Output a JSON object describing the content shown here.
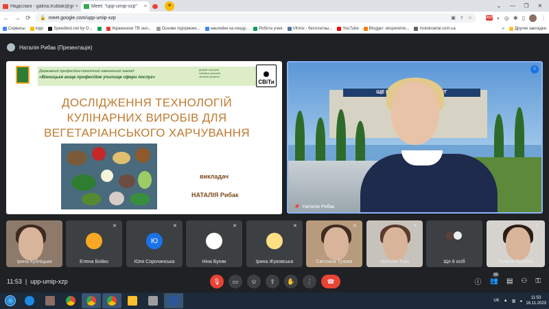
{
  "browser": {
    "tabs": [
      {
        "title": "Надіслані - galina.trublak@gm",
        "favicon_color": "#ea4335",
        "active": false
      },
      {
        "title": "Meet: \"upp-umip-xzp\"",
        "favicon_color": "#34a853",
        "active": true
      },
      {
        "title": "",
        "favicon_color": "#ea4335",
        "active": false
      }
    ],
    "tab_close": "×",
    "new_tab": "+",
    "window_controls": [
      "⌄",
      "—",
      "❐",
      "✕"
    ],
    "url": "meet.google.com/upp-umip-xzp",
    "nav_icons": [
      "←",
      "→",
      "⟳"
    ],
    "extension_badge": "ABP"
  },
  "bookmarks": [
    {
      "label": "Сервисы",
      "color": "#4285f4"
    },
    {
      "label": "logo",
      "color": "#fbbc04"
    },
    {
      "label": "Speedtest.net by O...",
      "color": "#1a1a1a"
    },
    {
      "label": "",
      "color": "#0f9d58"
    },
    {
      "label": "Украинское ТВ онл...",
      "color": "#e53935"
    },
    {
      "label": "Основи підприємн...",
      "color": "#9e9e9e"
    },
    {
      "label": "наклейки на конду...",
      "color": "#4285f4"
    },
    {
      "label": "Робота учня",
      "color": "#0f9d58"
    },
    {
      "label": "VKmix - бесплатны...",
      "color": "#4c75a3"
    },
    {
      "label": "YouTube",
      "color": "#ff0000"
    },
    {
      "label": "Blogger: ekspereme...",
      "color": "#f57c00"
    },
    {
      "label": "motokvartal.com.ua",
      "color": "#616161"
    }
  ],
  "bookmarks_more": "»",
  "bookmarks_folder": "Другие закладки",
  "meet": {
    "presenter_label": "Наталія Рибак (Презентація)",
    "slide": {
      "institution_line1": "Державний професійно-технічний навчальний заклад",
      "institution_line2": "«Вінницьке вище професійне училище сфери послуг»",
      "mottos": [
        "довіряй",
        "знай",
        "умій",
        "навчайся",
        "сучасний",
        "світовий",
        "професія"
      ],
      "logo_text": "СВіТи",
      "title_lines": [
        "ДОСЛІДЖЕННЯ ТЕХНОЛОГІЙ",
        "КУЛІНАРНИХ ВИРОБІВ ДЛЯ",
        "ВЕГЕТАРІАНСЬКОГО ХАРЧУВАННЯ"
      ],
      "lecturer_label": "викладач",
      "lecturer_name": "НАТАЛІЯ Рибак"
    },
    "speaker": {
      "name": "Наталія Рибак",
      "sign_text": "ЩЕ ПРОФЕС... ФЕРИ ПОСЛУГ"
    },
    "participants": [
      {
        "name": "Ірина Кубліцька",
        "type": "video",
        "muted": false
      },
      {
        "name": "Елена Бойко",
        "type": "avatar",
        "muted": true,
        "avatar_color": "#f9a825"
      },
      {
        "name": "Юля Сорочинська",
        "type": "letter",
        "muted": true,
        "letter": "Ю"
      },
      {
        "name": "Ніна Буняк",
        "type": "avatar",
        "muted": true,
        "avatar_color": "#ffffff"
      },
      {
        "name": "Ірина Жуковська",
        "type": "avatar",
        "muted": true,
        "avatar_color": "#ffe082"
      },
      {
        "name": "Світлана Тузова",
        "type": "video",
        "muted": true
      },
      {
        "name": "Наталія Ткач",
        "type": "video",
        "muted": true
      },
      {
        "name": "Ще 8 осіб",
        "type": "more",
        "muted": false
      },
      {
        "name": "Галина Трубляк",
        "type": "video",
        "muted": true
      }
    ]
  },
  "controls": {
    "time": "11:53",
    "separator": "|",
    "meeting_code": "upp-umip-xzp",
    "buttons": [
      "mic-off",
      "camera",
      "emoji",
      "present",
      "raise-hand",
      "more",
      "hang-up"
    ],
    "people_count": "16"
  },
  "taskbar": {
    "language": "UK",
    "time": "11:53",
    "date": "16.11.2023"
  }
}
